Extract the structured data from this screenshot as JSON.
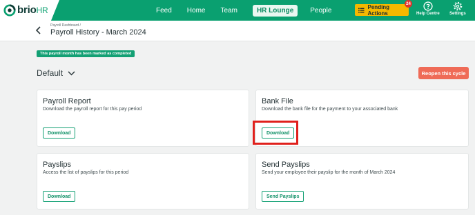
{
  "brand": {
    "name": "brio",
    "suffix": "HR"
  },
  "nav": {
    "items": [
      "Feed",
      "Home",
      "Team",
      "HR Lounge",
      "People"
    ],
    "active": "HR Lounge"
  },
  "pending": {
    "label": "Pending Actions",
    "count": "24"
  },
  "help": {
    "label": "Help Centre"
  },
  "settings": {
    "label": "Settings"
  },
  "header": {
    "breadcrumb": "Payroll Dashboard /",
    "title": "Payroll History - March 2024"
  },
  "status_message": "This payroll month has been marked as completed",
  "cycle": {
    "label": "Default"
  },
  "reopen_label": "Reopen this cycle",
  "cards": [
    {
      "title": "Payroll Report",
      "description": "Download the payroll report for this pay period",
      "button": "Download"
    },
    {
      "title": "Bank File",
      "description": "Download the bank file for the payment to your associated bank",
      "button": "Download"
    },
    {
      "title": "Payslips",
      "description": "Access the list of payslips for this period",
      "button": "Download"
    },
    {
      "title": "Send Payslips",
      "description": "Send your employee their payslip for the month of March 2024",
      "button": "Send Payslips"
    }
  ],
  "colors": {
    "brand_green": "#0aa070",
    "pending_yellow": "#f5b800",
    "reopen_red": "#ef6b57",
    "highlight_red": "#e0201c"
  },
  "icons": [
    "brio-logo-icon",
    "list-icon",
    "help-icon",
    "gear-icon",
    "back-arrow-icon",
    "chevron-down-icon"
  ]
}
